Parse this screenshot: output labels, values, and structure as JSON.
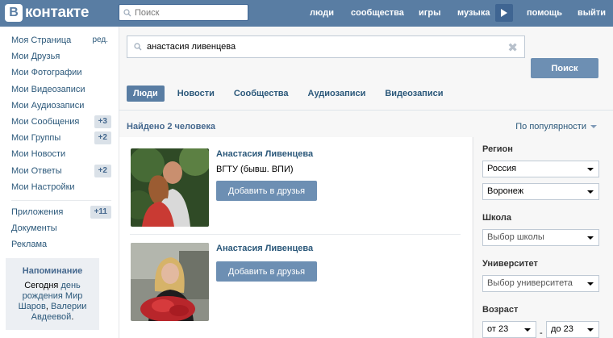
{
  "header": {
    "logo_letter": "В",
    "logo_text": "контакте",
    "search_placeholder": "Поиск",
    "nav": [
      "люди",
      "сообщества",
      "игры",
      "музыка",
      "помощь",
      "выйти"
    ],
    "accent": "#597da3"
  },
  "left_menu": {
    "items": [
      {
        "label": "Моя Страница",
        "extra": "ред."
      },
      {
        "label": "Мои Друзья",
        "extra": ""
      },
      {
        "label": "Мои Фотографии",
        "extra": ""
      },
      {
        "label": "Мои Видеозаписи",
        "extra": ""
      },
      {
        "label": "Мои Аудиозаписи",
        "extra": ""
      },
      {
        "label": "Мои Сообщения",
        "extra": "+3"
      },
      {
        "label": "Мои Группы",
        "extra": "+2"
      },
      {
        "label": "Мои Новости",
        "extra": ""
      },
      {
        "label": "Мои Ответы",
        "extra": "+2"
      },
      {
        "label": "Мои Настройки",
        "extra": ""
      }
    ],
    "items2": [
      {
        "label": "Приложения",
        "extra": "+11"
      },
      {
        "label": "Документы",
        "extra": ""
      },
      {
        "label": "Реклама",
        "extra": ""
      }
    ]
  },
  "reminder": {
    "title": "Напоминание",
    "text_1": "Сегодня",
    "text_2": "день рождения",
    "link_1": "Мир Шаров",
    "text_3": ",",
    "link_2": "Валерии Авдеевой",
    "text_4": "."
  },
  "search": {
    "query": "анастасия ливенцева",
    "button": "Поиск",
    "clear_icon": "✖"
  },
  "tabs": [
    "Люди",
    "Новости",
    "Сообщества",
    "Аудиозаписи",
    "Видеозаписи"
  ],
  "results": {
    "found": "Найдено 2 человека",
    "sort": "По популярности",
    "people": [
      {
        "name": "Анастасия Ливенцева",
        "university": "ВГТУ (бывш. ВПИ)",
        "button": "Добавить в друзья"
      },
      {
        "name": "Анастасия Ливенцева",
        "university": "",
        "button": "Добавить в друзья"
      }
    ]
  },
  "filters": {
    "region_label": "Регион",
    "country": "Россия",
    "city": "Воронеж",
    "school_label": "Школа",
    "school": "Выбор школы",
    "university_label": "Университет",
    "university": "Выбор университета",
    "age_label": "Возраст",
    "age_from": "от 23",
    "age_dash": "-",
    "age_to": "до 23"
  }
}
